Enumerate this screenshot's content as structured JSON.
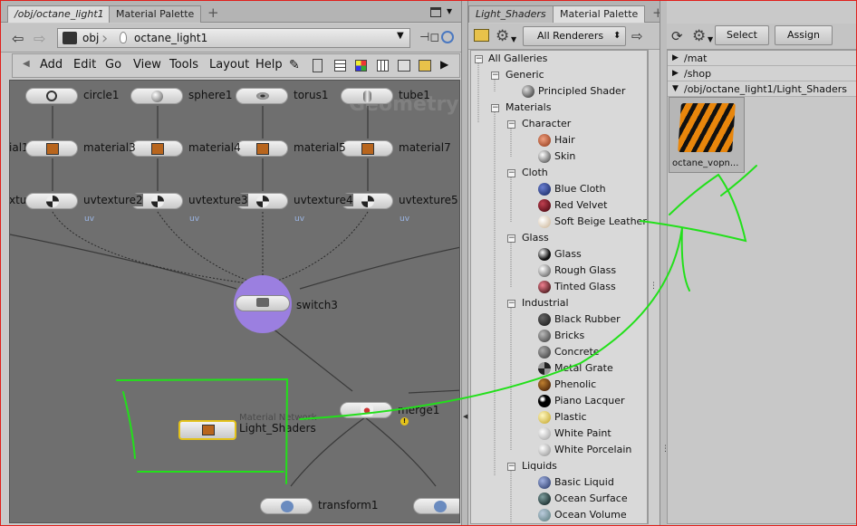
{
  "left_pane": {
    "tabs": [
      {
        "label": "/obj/octane_light1"
      },
      {
        "label": "Material Palette"
      }
    ],
    "path": {
      "root": "obj",
      "node": "octane_light1"
    },
    "menu": [
      "Add",
      "Edit",
      "Go",
      "View",
      "Tools",
      "Layout",
      "Help"
    ],
    "network": {
      "watermark": "Geometry",
      "nodes": {
        "circle1": "circle1",
        "sphere1": "sphere1",
        "torus1": "torus1",
        "tube1": "tube1",
        "material_partial": "ial1",
        "material3": "material3",
        "material4": "material4",
        "material5": "material5",
        "material7": "material7",
        "uvtexture_partial": "xture1",
        "uvtexture2": "uvtexture2",
        "uvtexture3": "uvtexture3",
        "uvtexture4": "uvtexture4",
        "uvtexture5": "uvtexture5",
        "uv": "uv",
        "switch3": "switch3",
        "merge1": "merge1",
        "matnet_type": "Material Network",
        "matnet_name": "Light_Shaders",
        "transform1": "transform1"
      }
    }
  },
  "middle_pane": {
    "tabs": [
      {
        "label": "Light_Shaders"
      },
      {
        "label": "Material Palette"
      }
    ],
    "renderer_select": "All Renderers",
    "tree": {
      "root": "All Galleries",
      "generic": "Generic",
      "principled": "Principled Shader",
      "materials": "Materials",
      "character": "Character",
      "hair": "Hair",
      "skin": "Skin",
      "cloth": "Cloth",
      "blue_cloth": "Blue Cloth",
      "red_velvet": "Red Velvet",
      "soft_beige_leather": "Soft Beige Leather",
      "glass_group": "Glass",
      "glass": "Glass",
      "rough_glass": "Rough Glass",
      "tinted_glass": "Tinted Glass",
      "industrial": "Industrial",
      "black_rubber": "Black Rubber",
      "bricks": "Bricks",
      "concrete": "Concrete",
      "metal_grate": "Metal Grate",
      "phenolic": "Phenolic",
      "piano_lacquer": "Piano Lacquer",
      "plastic": "Plastic",
      "white_paint": "White Paint",
      "white_porcelain": "White Porcelain",
      "liquids": "Liquids",
      "basic_liquid": "Basic Liquid",
      "ocean_surface": "Ocean Surface",
      "ocean_volume": "Ocean Volume"
    }
  },
  "right_pane": {
    "select_label": "Select",
    "assign_label": "Assign",
    "locations": [
      "/mat",
      "/shop",
      "/obj/octane_light1/Light_Shaders"
    ],
    "material_thumb_label": "octane_vopn..."
  },
  "colors": {
    "annotation": "#22e01a",
    "selection": "#e3c21a",
    "switch_node": "#9b7fe0"
  }
}
